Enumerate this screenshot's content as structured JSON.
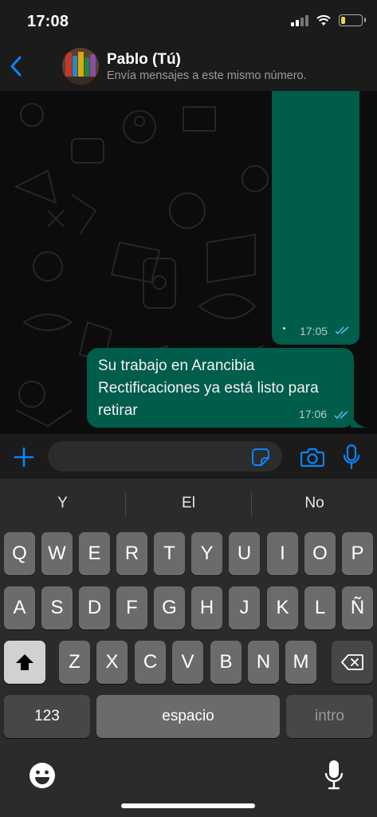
{
  "status_bar": {
    "time": "17:08",
    "battery_level": 0.2,
    "battery_color": "#f5d33d"
  },
  "header": {
    "contact_name": "Pablo (Tú)",
    "subtitle": "Envía mensajes a este mismo número."
  },
  "messages": [
    {
      "type": "media",
      "time": "17:05",
      "status": "read"
    },
    {
      "type": "text",
      "text": "Su trabajo en Arancibia Rectificaciones ya está listo para retirar",
      "time": "17:06",
      "status": "read"
    }
  ],
  "composer": {
    "placeholder": "",
    "value": ""
  },
  "keyboard": {
    "suggestions": [
      "Y",
      "El",
      "No"
    ],
    "row1": [
      "Q",
      "W",
      "E",
      "R",
      "T",
      "Y",
      "U",
      "I",
      "O",
      "P"
    ],
    "row2": [
      "A",
      "S",
      "D",
      "F",
      "G",
      "H",
      "J",
      "K",
      "L",
      "Ñ"
    ],
    "row3": [
      "Z",
      "X",
      "C",
      "V",
      "B",
      "N",
      "M"
    ],
    "numbers_key": "123",
    "space_key": "espacio",
    "return_key": "intro"
  },
  "colors": {
    "accent": "#0a84ff",
    "bubble": "#005c4b",
    "read_ticks": "#53bdeb"
  }
}
